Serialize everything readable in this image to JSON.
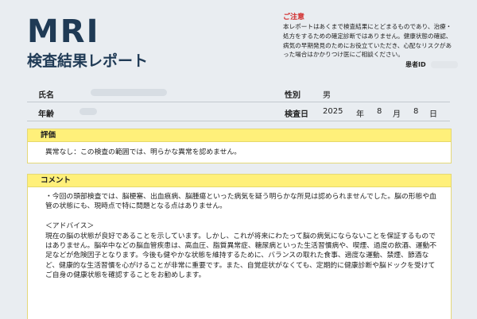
{
  "header": {
    "title": "MRI",
    "subtitle": "検査結果レポート"
  },
  "notice": {
    "title": "ご注意",
    "body": "本レポートはあくまで検査結果にとどまるものであり、治療・処方をするための確定診断ではありません。健康状態の確認、病気の早期発見のためにお役立ていただき、心配なリスクがあった場合はかかりつけ医にご相談ください。"
  },
  "patient_id_label": "患者ID",
  "info": {
    "name_label": "氏名",
    "sex_label": "性別",
    "sex_value": "男",
    "age_label": "年齢",
    "exam_date_label": "検査日",
    "year": "2025",
    "year_unit": "年",
    "month": "8",
    "month_unit": "月",
    "day": "8",
    "day_unit": "日"
  },
  "evaluation": {
    "heading": "評価",
    "text": "異常なし：この検査の範囲では、明らかな異常を認めません。"
  },
  "comment": {
    "heading": "コメント",
    "text": "・今回の頭部検査では、脳梗塞、出血痕病、脳腫瘍といった病気を疑う明らかな所見は認められませんでした。脳の形態や血管の状態にも、現時点で特に問題となる点はありません。\n\n＜アドバイス＞\n現在の脳の状態が良好であることを示しています。しかし、これが将来にわたって脳の病気にならないことを保証するものではありません。脳卒中などの脳血管疾患は、高血圧、脂質異常症、糖尿病といった生活習慣病や、喫煙、過度の飲酒、運動不足などが危険因子となります。今後も健やかな状態を維持するために、バランスの取れた食事、適度な運動、禁煙、節酒など、健康的な生活習慣を心がけることが非常に重要です。また、自覚症状がなくても、定期的に健康診断や脳ドックを受けてご自身の健康状態を確認することをお勧めします。"
  }
}
